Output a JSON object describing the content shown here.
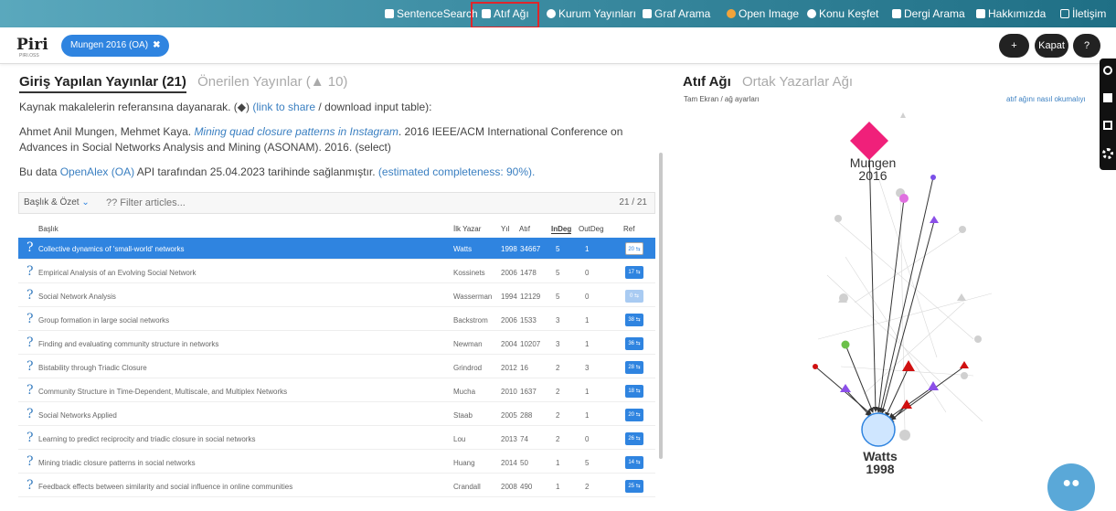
{
  "nav": {
    "items": [
      {
        "label": "SentenceSearch",
        "icon": "document-icon"
      },
      {
        "label": "Atıf Ağı",
        "icon": "book-icon"
      },
      {
        "label": "Kurum Yayınları",
        "icon": "link-icon"
      },
      {
        "label": "Graf Arama",
        "icon": "chart-icon"
      },
      {
        "label": "Open Image",
        "icon": "image-icon"
      },
      {
        "label": "Konu Keşfet",
        "icon": "compass-icon"
      },
      {
        "label": "Dergi Arama",
        "icon": "journal-icon"
      },
      {
        "label": "Hakkımızda",
        "icon": "id-card-icon"
      },
      {
        "label": "İletişim",
        "icon": "mail-icon"
      }
    ],
    "active": "Atıf Ağı"
  },
  "header": {
    "logo": "Piri",
    "logo_sub": "PIRI.OSS",
    "chip_label": "Mungen 2016 (OA)",
    "add_label": "+",
    "close_label": "Kapat",
    "help_label": "?"
  },
  "left": {
    "tab_active": "Giriş Yapılan Yayınlar (21)",
    "tab_inactive": "Önerilen Yayınlar (▲ 10)",
    "intro_a": "Kaynak makalelerin referansına dayanarak. (◆) ",
    "intro_link": "(link to share",
    "intro_b": " / download input table):",
    "cite_authors": "Ahmet Anil Mungen, Mehmet Kaya. ",
    "cite_title": "Mining quad closure patterns in Instagram",
    "cite_rest": ". 2016 IEEE/ACM International Conference on Advances in Social Networks Analysis and Mining (ASONAM). 2016. (select)",
    "source_a": "Bu data ",
    "source_link": "OpenAlex (OA)",
    "source_b": " API tarafından 25.04.2023 tarihinde sağlanmıştır. ",
    "source_est": "(estimated completeness: 90%).",
    "filter_select": "Başlık & Özet",
    "filter_placeholder": "?? Filter articles...",
    "count": "21 / 21"
  },
  "table": {
    "headers": [
      "Başlık",
      "İlk Yazar",
      "Yıl",
      "Atıf",
      "InDeg",
      "OutDeg",
      "Ref"
    ],
    "rows": [
      {
        "title": "Collective dynamics of 'small-world' networks",
        "author": "Watts",
        "year": "1998",
        "cites": "34667",
        "indeg": "5",
        "outdeg": "1",
        "ref": "20 ⇆",
        "selected": true
      },
      {
        "title": "Empirical Analysis of an Evolving Social Network",
        "author": "Kossinets",
        "year": "2006",
        "cites": "1478",
        "indeg": "5",
        "outdeg": "0",
        "ref": "17 ⇆"
      },
      {
        "title": "Social Network Analysis",
        "author": "Wasserman",
        "year": "1994",
        "cites": "12129",
        "indeg": "5",
        "outdeg": "0",
        "ref": "0 ⇆",
        "pale": true
      },
      {
        "title": "Group formation in large social networks",
        "author": "Backstrom",
        "year": "2006",
        "cites": "1533",
        "indeg": "3",
        "outdeg": "1",
        "ref": "38 ⇆"
      },
      {
        "title": "Finding and evaluating community structure in networks",
        "author": "Newman",
        "year": "2004",
        "cites": "10207",
        "indeg": "3",
        "outdeg": "1",
        "ref": "36 ⇆"
      },
      {
        "title": "Bistability through Triadic Closure",
        "author": "Grindrod",
        "year": "2012",
        "cites": "16",
        "indeg": "2",
        "outdeg": "3",
        "ref": "28 ⇆"
      },
      {
        "title": "Community Structure in Time-Dependent, Multiscale, and Multiplex Networks",
        "author": "Mucha",
        "year": "2010",
        "cites": "1637",
        "indeg": "2",
        "outdeg": "1",
        "ref": "18 ⇆"
      },
      {
        "title": "Social Networks Applied",
        "author": "Staab",
        "year": "2005",
        "cites": "288",
        "indeg": "2",
        "outdeg": "1",
        "ref": "20 ⇆"
      },
      {
        "title": "Learning to predict reciprocity and triadic closure in social networks",
        "author": "Lou",
        "year": "2013",
        "cites": "74",
        "indeg": "2",
        "outdeg": "0",
        "ref": "26 ⇆"
      },
      {
        "title": "Mining triadic closure patterns in social networks",
        "author": "Huang",
        "year": "2014",
        "cites": "50",
        "indeg": "1",
        "outdeg": "5",
        "ref": "14 ⇆"
      },
      {
        "title": "Feedback effects between similarity and social influence in online communities",
        "author": "Crandall",
        "year": "2008",
        "cites": "490",
        "indeg": "1",
        "outdeg": "2",
        "ref": "25 ⇆"
      }
    ]
  },
  "right": {
    "tab_active": "Atıf Ağı",
    "tab_inactive": "Ortak Yazarlar Ağı",
    "fullscreen": "Tam Ekran / ağ ayarları",
    "howto": "atıf ağını nasıl okumalıyı",
    "node_top_label1": "Mungen",
    "node_top_label2": "2016",
    "node_bottom_label1": "Watts",
    "node_bottom_label2": "1998"
  },
  "colors": {
    "accent": "#2f84e0",
    "highlight": "#e0262b",
    "magenta": "#f0207a",
    "purple": "#8b4fe8",
    "red": "#d01010",
    "green": "#6cc04a",
    "watts_node": "#cfe6ff"
  }
}
